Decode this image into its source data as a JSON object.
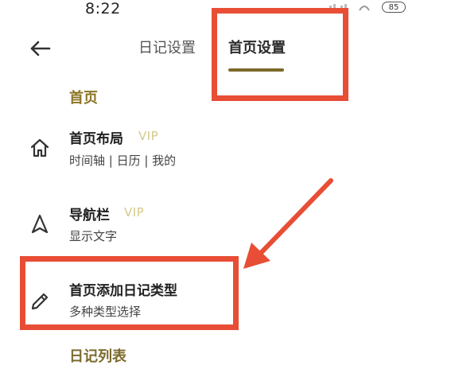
{
  "status_bar": {
    "time": "8:22",
    "battery": "85"
  },
  "header": {
    "tabs": [
      {
        "label": "日记设置",
        "active": false
      },
      {
        "label": "首页设置",
        "active": true
      }
    ]
  },
  "sections": {
    "home_header": "首页",
    "list_header": "日记列表"
  },
  "rows": [
    {
      "title": "首页布局",
      "badge": "VIP",
      "subtitle": "时间轴 | 日历 | 我的",
      "icon": "home-icon"
    },
    {
      "title": "导航栏",
      "badge": "VIP",
      "subtitle": "显示文字",
      "icon": "navigation-icon"
    },
    {
      "title": "首页添加日记类型",
      "subtitle": "多种类型选择",
      "icon": "pencil-icon"
    }
  ],
  "colors": {
    "accent": "#8b7425",
    "annotation": "#e84e35",
    "vip": "#d4c98a"
  }
}
